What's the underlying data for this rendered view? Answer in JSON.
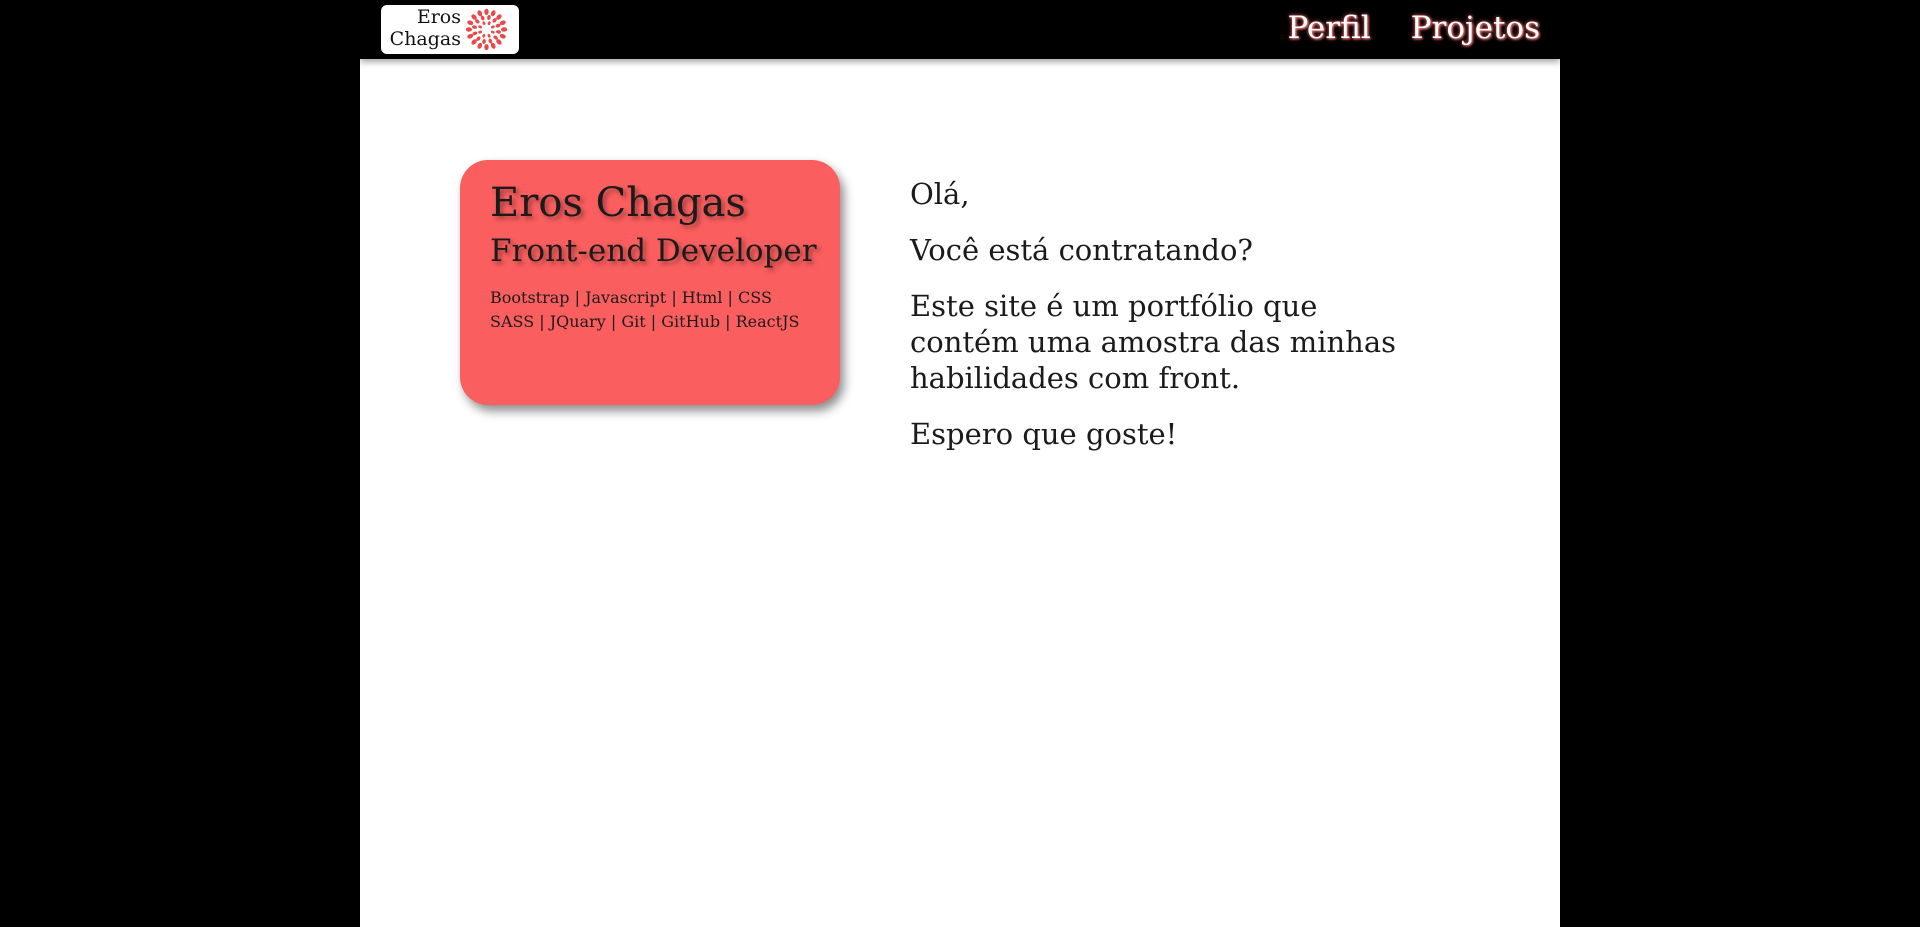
{
  "logo": {
    "line1": "Eros",
    "line2": "Chagas",
    "mark_color": "#e84a4a"
  },
  "nav": {
    "items": [
      {
        "label": "Perfil"
      },
      {
        "label": "Projetos"
      }
    ]
  },
  "card": {
    "name": "Eros Chagas",
    "role": "Front-end Developer",
    "skills_line1": "Bootstrap | Javascript | Html | CSS",
    "skills_line2": "SASS | JQuary | Git | GitHub | ReactJS",
    "color": "#fa5e5e"
  },
  "intro": {
    "greeting": "Olá,",
    "question": "Você está contratando?",
    "description": "Este site é um portfólio que contém uma amostra das minhas habilidades com front.",
    "closing": "Espero que goste!"
  }
}
